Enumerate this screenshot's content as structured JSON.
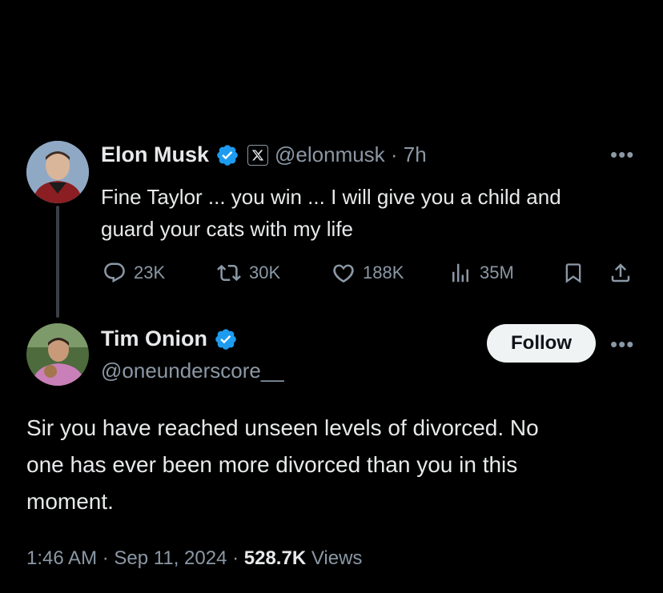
{
  "parent_tweet": {
    "author_name": "Elon Musk",
    "handle_and_time": "@elonmusk · 7h",
    "text_line1": "Fine Taylor ... you win ... I will give you a child and",
    "text_line2": "guard your cats with my life",
    "stats": {
      "replies": "23K",
      "reposts": "30K",
      "likes": "188K",
      "views": "35M"
    }
  },
  "reply_tweet": {
    "author_name": "Tim Onion",
    "handle": "@oneunderscore__",
    "follow_label": "Follow",
    "text_line1": "Sir you have reached unseen levels of divorced. No",
    "text_line2": "one has ever been more divorced than you in this",
    "text_line3": "moment.",
    "time": "1:46 AM",
    "date": "Sep 11, 2024",
    "view_count": "528.7K",
    "views_label": "Views",
    "separator": "·"
  },
  "icons": [
    "avatar",
    "verified-badge-icon",
    "x-logo-icon",
    "reply-icon",
    "repost-icon",
    "like-icon",
    "views-icon",
    "bookmark-icon",
    "share-icon",
    "more-icon"
  ],
  "colors": {
    "background": "#000000",
    "text": "#e7e9ea",
    "muted": "#8b98a5",
    "verified": "#1d9bf0",
    "follow_bg": "#eff3f4"
  }
}
